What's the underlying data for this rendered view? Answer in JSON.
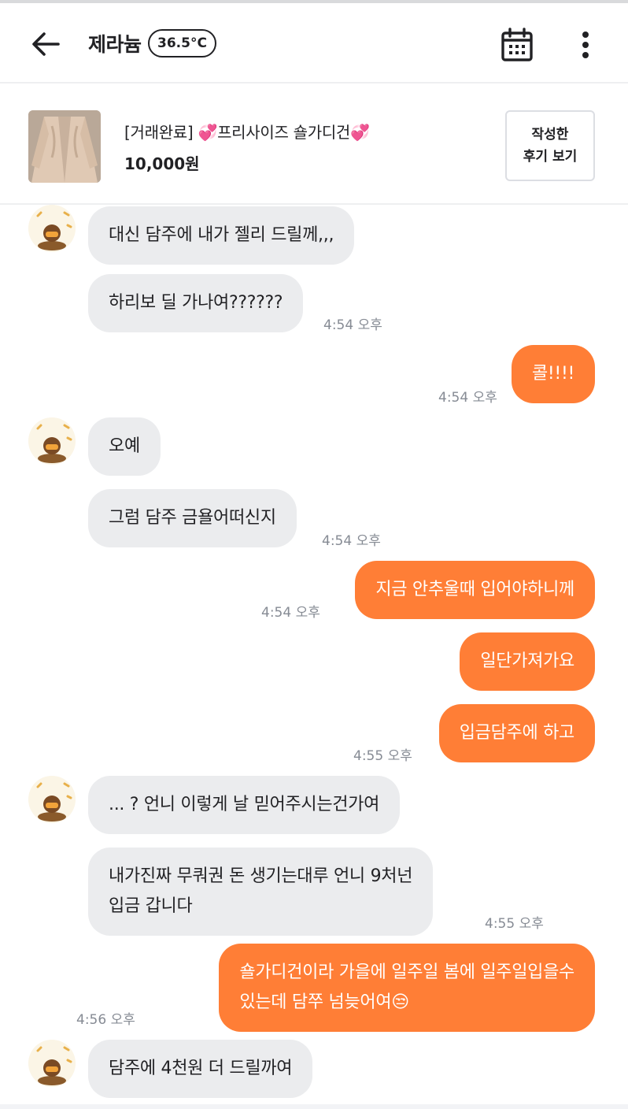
{
  "header": {
    "nickname": "제라늄",
    "temperature": "36.5°C"
  },
  "product": {
    "title": "[거래완료] 💞프리사이즈 숄가디건💞",
    "price": "10,000원",
    "review_button": "작성한\n후기 보기"
  },
  "colors": {
    "accent": "#ff7e36",
    "incoming_bubble": "#ebecee",
    "timestamp": "#868b94"
  },
  "messages": [
    {
      "dir": "in",
      "text": "대신 담주에 내가 젤리 드릴께,,,",
      "time": ""
    },
    {
      "dir": "in",
      "text": "하리보 딜 가나여??????",
      "time": "4:54 오후"
    },
    {
      "dir": "out",
      "text": "콜!!!!",
      "time": "4:54 오후"
    },
    {
      "dir": "in",
      "text": "오예",
      "time": ""
    },
    {
      "dir": "in",
      "text": "그럼 담주 금욜어떠신지",
      "time": "4:54 오후"
    },
    {
      "dir": "out",
      "text": "지금 안추울때 입어야하니께",
      "time": "4:54 오후"
    },
    {
      "dir": "out",
      "text": "일단가져가요",
      "time": ""
    },
    {
      "dir": "out",
      "text": "입금담주에 하고",
      "time": "4:55 오후"
    },
    {
      "dir": "in",
      "text": "... ? 언니 이렇게 날 믿어주시는건가여",
      "time": ""
    },
    {
      "dir": "in",
      "text": "내가진짜 무쿼권 돈 생기는대루 언니 9처넌\n입금 갑니다",
      "time": "4:55 오후"
    },
    {
      "dir": "out",
      "text": "숄가디건이라 가을에 일주일 봄에 일주일입을수\n있는데 담쭈 넘늦어여😒",
      "time": "4:56 오후"
    },
    {
      "dir": "in",
      "text": "담주에 4천원 더 드릴까여",
      "time": ""
    }
  ]
}
